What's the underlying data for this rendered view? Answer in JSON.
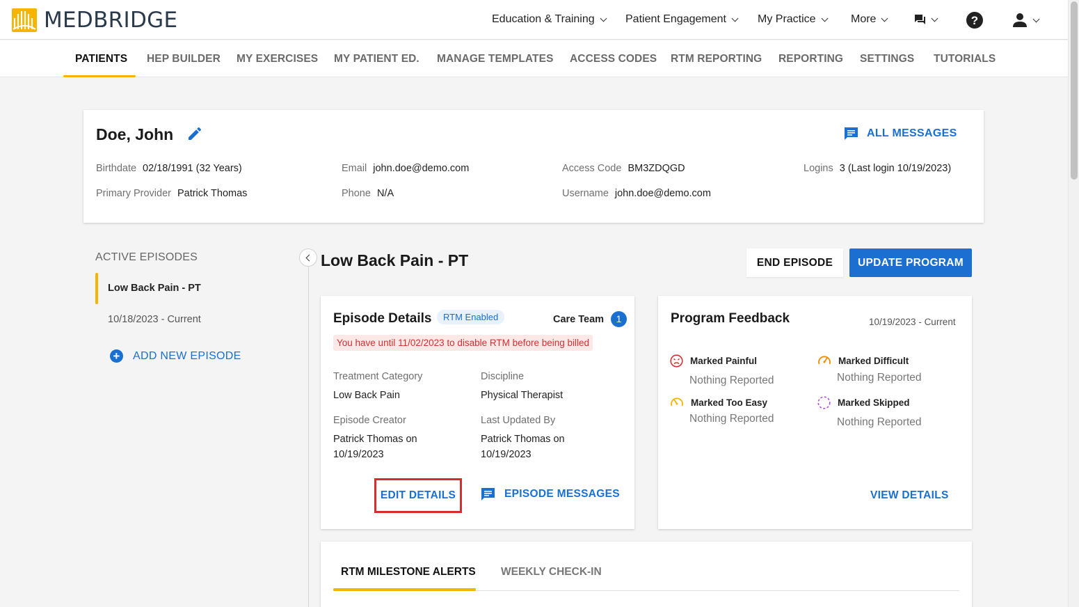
{
  "brand": {
    "name": "MEDBRIDGE",
    "accent": "#f5b400",
    "primary": "#1a6fd1"
  },
  "topnav": {
    "items": [
      {
        "label": "Education & Training"
      },
      {
        "label": "Patient Engagement"
      },
      {
        "label": "My Practice"
      },
      {
        "label": "More"
      }
    ],
    "messages_icon": "chat-icon",
    "help_icon": "help-icon",
    "account_icon": "user-icon"
  },
  "subnav": {
    "items": [
      {
        "label": "PATIENTS",
        "active": true
      },
      {
        "label": "HEP BUILDER"
      },
      {
        "label": "MY EXERCISES"
      },
      {
        "label": "MY PATIENT ED."
      },
      {
        "label": "MANAGE TEMPLATES"
      },
      {
        "label": "ACCESS CODES"
      },
      {
        "label": "RTM REPORTING"
      },
      {
        "label": "REPORTING"
      },
      {
        "label": "SETTINGS"
      },
      {
        "label": "TUTORIALS"
      }
    ]
  },
  "patient": {
    "name": "Doe, John",
    "all_messages": "ALL MESSAGES",
    "fields": {
      "birthdate": {
        "label": "Birthdate",
        "value": "02/18/1991 (32 Years)"
      },
      "primary_provider": {
        "label": "Primary Provider",
        "value": "Patrick Thomas"
      },
      "email": {
        "label": "Email",
        "value": "john.doe@demo.com"
      },
      "phone": {
        "label": "Phone",
        "value": "N/A"
      },
      "access_code": {
        "label": "Access Code",
        "value": "BM3ZDQGD"
      },
      "username": {
        "label": "Username",
        "value": "john.doe@demo.com"
      },
      "logins": {
        "label": "Logins",
        "value": "3 (Last login 10/19/2023)"
      }
    }
  },
  "episodes": {
    "title": "ACTIVE EPISODES",
    "active_name": "Low Back Pain - PT",
    "active_date": "10/18/2023 - Current",
    "add_label": "ADD NEW EPISODE"
  },
  "episode": {
    "title": "Low Back Pain - PT",
    "end_button": "END EPISODE",
    "update_button": "UPDATE PROGRAM",
    "details": {
      "title": "Episode Details",
      "badge": "RTM Enabled",
      "care_team_label": "Care Team",
      "care_team_count": "1",
      "warning": "You have until 11/02/2023 to disable RTM before being billed",
      "treatment_category_label": "Treatment Category",
      "treatment_category": "Low Back Pain",
      "discipline_label": "Discipline",
      "discipline": "Physical Therapist",
      "creator_label": "Episode Creator",
      "creator_line1": "Patrick Thomas on",
      "creator_line2": "10/19/2023",
      "updated_label": "Last Updated By",
      "updated_line1": "Patrick Thomas on",
      "updated_line2": "10/19/2023",
      "edit_button": "EDIT DETAILS",
      "messages_button": "EPISODE MESSAGES"
    },
    "feedback": {
      "title": "Program Feedback",
      "date": "10/19/2023 - Current",
      "painful": {
        "label": "Marked Painful",
        "value": "Nothing Reported"
      },
      "difficult": {
        "label": "Marked Difficult",
        "value": "Nothing Reported"
      },
      "too_easy": {
        "label": "Marked Too Easy",
        "value": "Nothing Reported"
      },
      "skipped": {
        "label": "Marked Skipped",
        "value": "Nothing Reported"
      },
      "view_details": "VIEW DETAILS"
    },
    "tabs": [
      {
        "label": "RTM MILESTONE ALERTS",
        "active": true
      },
      {
        "label": "WEEKLY CHECK-IN"
      }
    ]
  }
}
